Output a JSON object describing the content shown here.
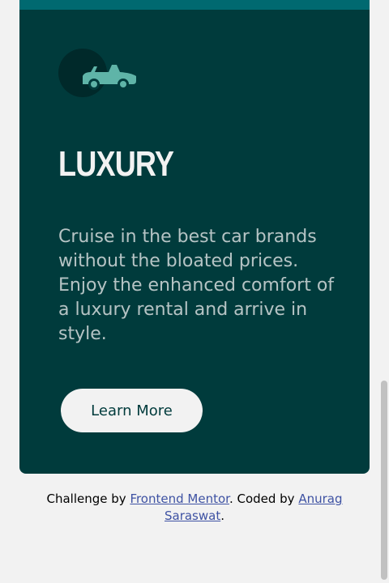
{
  "card": {
    "icon": "car-convertible-icon",
    "heading": "LUXURY",
    "description": "Cruise in the best car brands without the bloated prices. Enjoy the enhanced comfort of a luxury rental and arrive in style.",
    "button_label": "Learn More",
    "colors": {
      "background": "#003b3c",
      "text": "#f2f2f2",
      "previous_card": "#006970"
    }
  },
  "attribution": {
    "prefix": "Challenge by ",
    "link1": "Frontend Mentor",
    "middle": ". Coded by ",
    "link2": "Anurag Saraswat",
    "suffix": ".",
    "link_color": "#3e52a3"
  }
}
